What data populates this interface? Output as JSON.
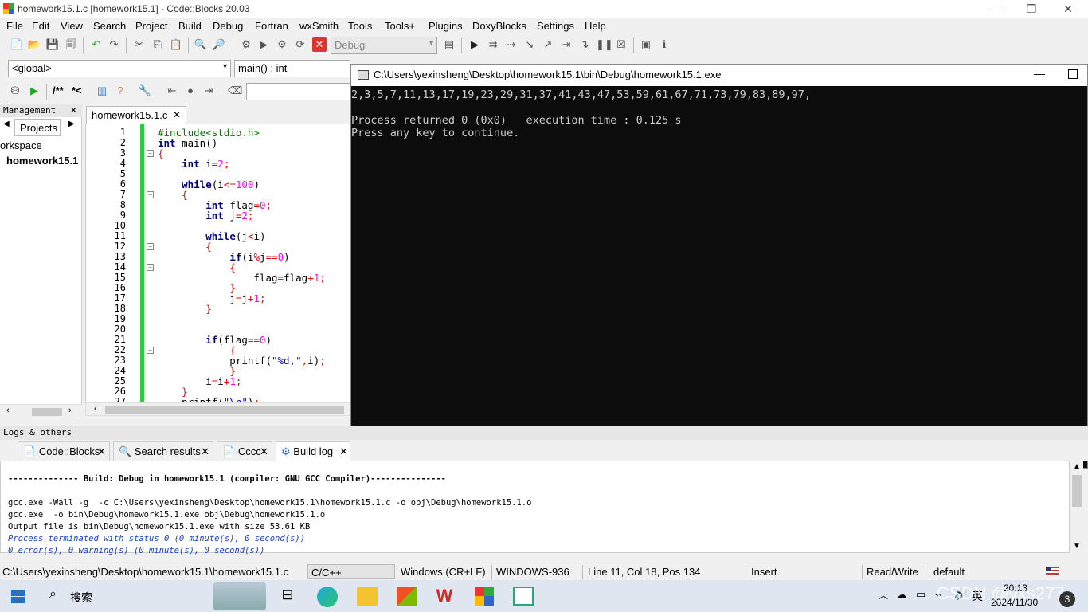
{
  "window": {
    "title": "homework15.1.c [homework15.1] - Code::Blocks 20.03"
  },
  "menu": [
    "File",
    "Edit",
    "View",
    "Search",
    "Project",
    "Build",
    "Debug",
    "Fortran",
    "wxSmith",
    "Tools",
    "Tools+",
    "Plugins",
    "DoxyBlocks",
    "Settings",
    "Help"
  ],
  "toolbar": {
    "build_target": "Debug",
    "scope": "<global>",
    "function": "main() : int",
    "doc_comment": "/**",
    "line_comment": "*<"
  },
  "management": {
    "header": "Management",
    "tab": "Projects",
    "workspace": "orkspace",
    "project": "homework15.1"
  },
  "editor": {
    "tab": "homework15.1.c",
    "lines": [
      {
        "n": "1",
        "code": "#include<stdio.h>"
      },
      {
        "n": "2",
        "code": "int main()"
      },
      {
        "n": "3",
        "code": "{"
      },
      {
        "n": "4",
        "code": "    int i=2;"
      },
      {
        "n": "5",
        "code": ""
      },
      {
        "n": "6",
        "code": "    while(i<=100)"
      },
      {
        "n": "7",
        "code": "    {"
      },
      {
        "n": "8",
        "code": "        int flag=0;"
      },
      {
        "n": "9",
        "code": "        int j=2;"
      },
      {
        "n": "10",
        "code": ""
      },
      {
        "n": "11",
        "code": "        while(j<i)"
      },
      {
        "n": "12",
        "code": "        {"
      },
      {
        "n": "13",
        "code": "            if(i%j==0)"
      },
      {
        "n": "14",
        "code": "            {"
      },
      {
        "n": "15",
        "code": "                flag=flag+1;"
      },
      {
        "n": "16",
        "code": "            }"
      },
      {
        "n": "17",
        "code": "            j=j+1;"
      },
      {
        "n": "18",
        "code": "        }"
      },
      {
        "n": "19",
        "code": ""
      },
      {
        "n": "20",
        "code": ""
      },
      {
        "n": "21",
        "code": "        if(flag==0)"
      },
      {
        "n": "22",
        "code": "            {"
      },
      {
        "n": "23",
        "code": "            printf(\"%d,\",i);"
      },
      {
        "n": "24",
        "code": "            }"
      },
      {
        "n": "25",
        "code": "        i=i+1;"
      },
      {
        "n": "26",
        "code": "    }"
      },
      {
        "n": "27",
        "code": "    printf(\"\\n\");"
      }
    ]
  },
  "console": {
    "title": "C:\\Users\\yexinsheng\\Desktop\\homework15.1\\bin\\Debug\\homework15.1.exe",
    "output": [
      "2,3,5,7,11,13,17,19,23,29,31,37,41,43,47,53,59,61,67,71,73,79,83,89,97,",
      "",
      "Process returned 0 (0x0)   execution time : 0.125 s",
      "Press any key to continue."
    ]
  },
  "logs": {
    "header": "Logs & others",
    "tabs": [
      "Code::Blocks",
      "Search results",
      "Cccc",
      "Build log"
    ],
    "build_log": [
      {
        "text": "-------------- Build: Debug in homework15.1 (compiler: GNU GCC Compiler)---------------",
        "style": "bold"
      },
      {
        "text": "",
        "style": "normal"
      },
      {
        "text": "gcc.exe -Wall -g  -c C:\\Users\\yexinsheng\\Desktop\\homework15.1\\homework15.1.c -o obj\\Debug\\homework15.1.o",
        "style": "normal"
      },
      {
        "text": "gcc.exe  -o bin\\Debug\\homework15.1.exe obj\\Debug\\homework15.1.o",
        "style": "normal"
      },
      {
        "text": "Output file is bin\\Debug\\homework15.1.exe with size 53.61 KB",
        "style": "normal"
      },
      {
        "text": "Process terminated with status 0 (0 minute(s), 0 second(s))",
        "style": "blue"
      },
      {
        "text": "0 error(s), 0 warning(s) (0 minute(s), 0 second(s))",
        "style": "blue"
      }
    ]
  },
  "status": {
    "path": "C:\\Users\\yexinsheng\\Desktop\\homework15.1\\homework15.1.c",
    "language": "C/C++",
    "eol": "Windows (CR+LF)",
    "encoding": "WINDOWS-936",
    "position": "Line 11, Col 18, Pos 134",
    "mode": "Insert",
    "access": "Read/Write",
    "profile": "default"
  },
  "taskbar": {
    "search": "搜索",
    "time": "20:13",
    "date": "2024/11/30",
    "ime": "英",
    "watermark": "CSDN @yxs277",
    "notif_count": "3"
  },
  "colors": {
    "accent_green": "#2ecc40",
    "console_bg": "#0c0c0c",
    "keyword": "#00008b",
    "preprocessor": "#008000"
  }
}
